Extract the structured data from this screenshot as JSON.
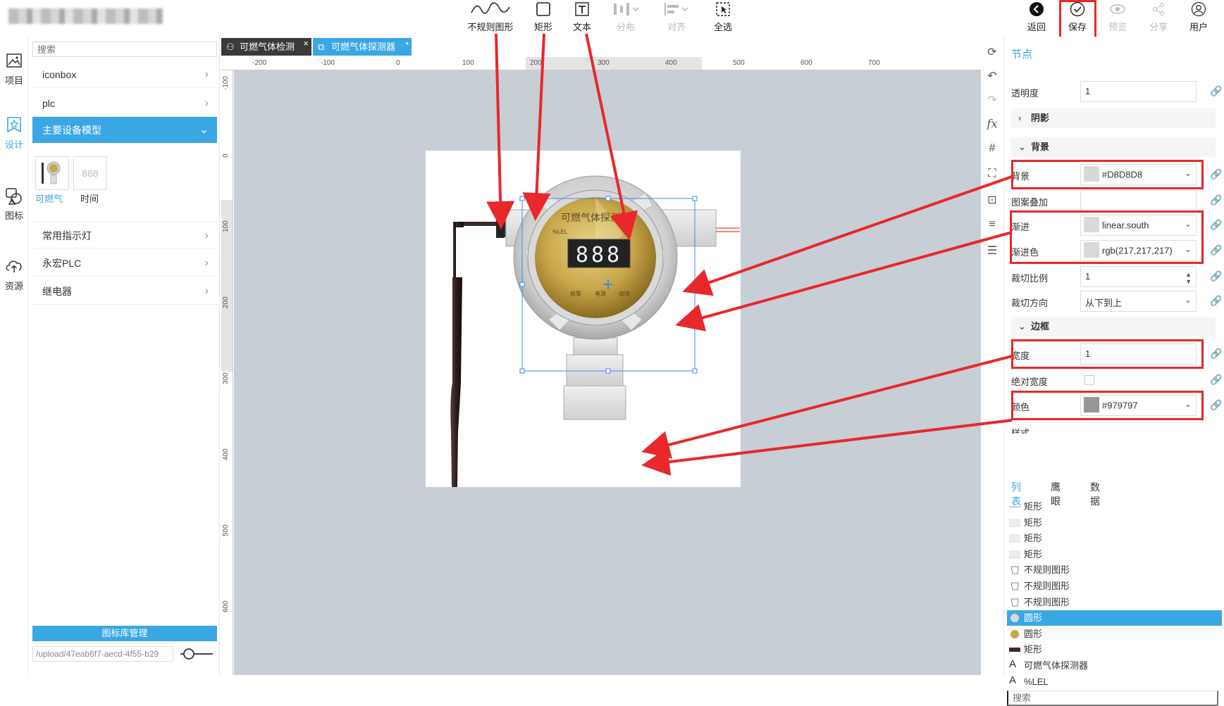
{
  "toolbar": {
    "tools": [
      {
        "label": "不规则图形",
        "icon": "freeform-icon"
      },
      {
        "label": "矩形",
        "icon": "rectangle-icon"
      },
      {
        "label": "文本",
        "icon": "text-icon"
      },
      {
        "label": "分布",
        "icon": "distribute-icon"
      },
      {
        "label": "对齐",
        "icon": "align-icon"
      },
      {
        "label": "全选",
        "icon": "select-all-icon"
      }
    ],
    "right": [
      {
        "label": "返回",
        "icon": "back-icon"
      },
      {
        "label": "保存",
        "icon": "save-icon"
      },
      {
        "label": "预览",
        "icon": "preview-icon"
      },
      {
        "label": "分享",
        "icon": "share-icon"
      },
      {
        "label": "用户",
        "icon": "user-icon"
      }
    ]
  },
  "rail": [
    {
      "label": "项目",
      "icon": "project-icon"
    },
    {
      "label": "设计",
      "icon": "design-icon"
    },
    {
      "label": "图标",
      "icon": "icon-library-icon"
    },
    {
      "label": "资源",
      "icon": "resources-icon"
    }
  ],
  "library": {
    "search_placeholder": "搜索",
    "groups_top": [
      "iconbox",
      "plc"
    ],
    "selected_group": "主要设备模型",
    "items": [
      {
        "label": "可燃气",
        "thumb_text": ""
      },
      {
        "label": "时间",
        "thumb_text": "888"
      }
    ],
    "groups_bottom": [
      "常用指示灯",
      "永宏PLC",
      "继电器"
    ],
    "manage_label": "图标库管理",
    "path_value": "/upload/47eab6f7-aecd-4f55-b29"
  },
  "tabs": [
    {
      "label": "可燃气体检测"
    },
    {
      "label": "可燃气体探测器"
    }
  ],
  "ruler": {
    "top": [
      "-200",
      "-100",
      "0",
      "100",
      "200",
      "300",
      "400",
      "500",
      "600",
      "700"
    ],
    "left": [
      "-100",
      "0",
      "100",
      "200",
      "300",
      "400",
      "500",
      "600"
    ]
  },
  "device": {
    "title": "可燃气体探测器",
    "unit": "%LEL",
    "digits": "888",
    "indicators": [
      "报警",
      "电源",
      "故障"
    ]
  },
  "props": {
    "panel_title": "节点",
    "opacity_label": "透明度",
    "opacity_value": "1",
    "shadow_section": "阴影",
    "bg_section": "背景",
    "bg_label": "背景",
    "bg_value": "#D8D8D8",
    "pattern_label": "图案叠加",
    "gradient_label": "渐进",
    "gradient_value": "linear.south",
    "gradient_color_label": "渐进色",
    "gradient_color_value": "rgb(217,217,217)",
    "clip_ratio_label": "裁切比例",
    "clip_ratio_value": "1",
    "clip_dir_label": "裁切方向",
    "clip_dir_value": "从下到上",
    "border_section": "边框",
    "width_label": "宽度",
    "width_value": "1",
    "abs_width_label": "绝对宽度",
    "color_label": "颜色",
    "color_value": "#979797",
    "style_label": "样式",
    "colors": {
      "bg": "#D8D8D8",
      "grad": "#D9D9D9",
      "border": "#979797"
    }
  },
  "bottom_tabs": [
    "列表",
    "鹰眼",
    "数据"
  ],
  "layers": [
    {
      "label": "矩形",
      "kind": "line"
    },
    {
      "label": "矩形",
      "kind": "rect"
    },
    {
      "label": "矩形",
      "kind": "rect"
    },
    {
      "label": "矩形",
      "kind": "rect"
    },
    {
      "label": "不规则图形",
      "kind": "poly"
    },
    {
      "label": "不规则图形",
      "kind": "poly"
    },
    {
      "label": "不规则图形",
      "kind": "poly"
    },
    {
      "label": "圆形",
      "kind": "circle-grey",
      "selected": true
    },
    {
      "label": "圆形",
      "kind": "circle-gold"
    },
    {
      "label": "矩形",
      "kind": "rect-dark"
    },
    {
      "label": "可燃气体探测器",
      "kind": "text"
    },
    {
      "label": "%LEL",
      "kind": "text"
    }
  ],
  "layer_search_placeholder": "搜索"
}
